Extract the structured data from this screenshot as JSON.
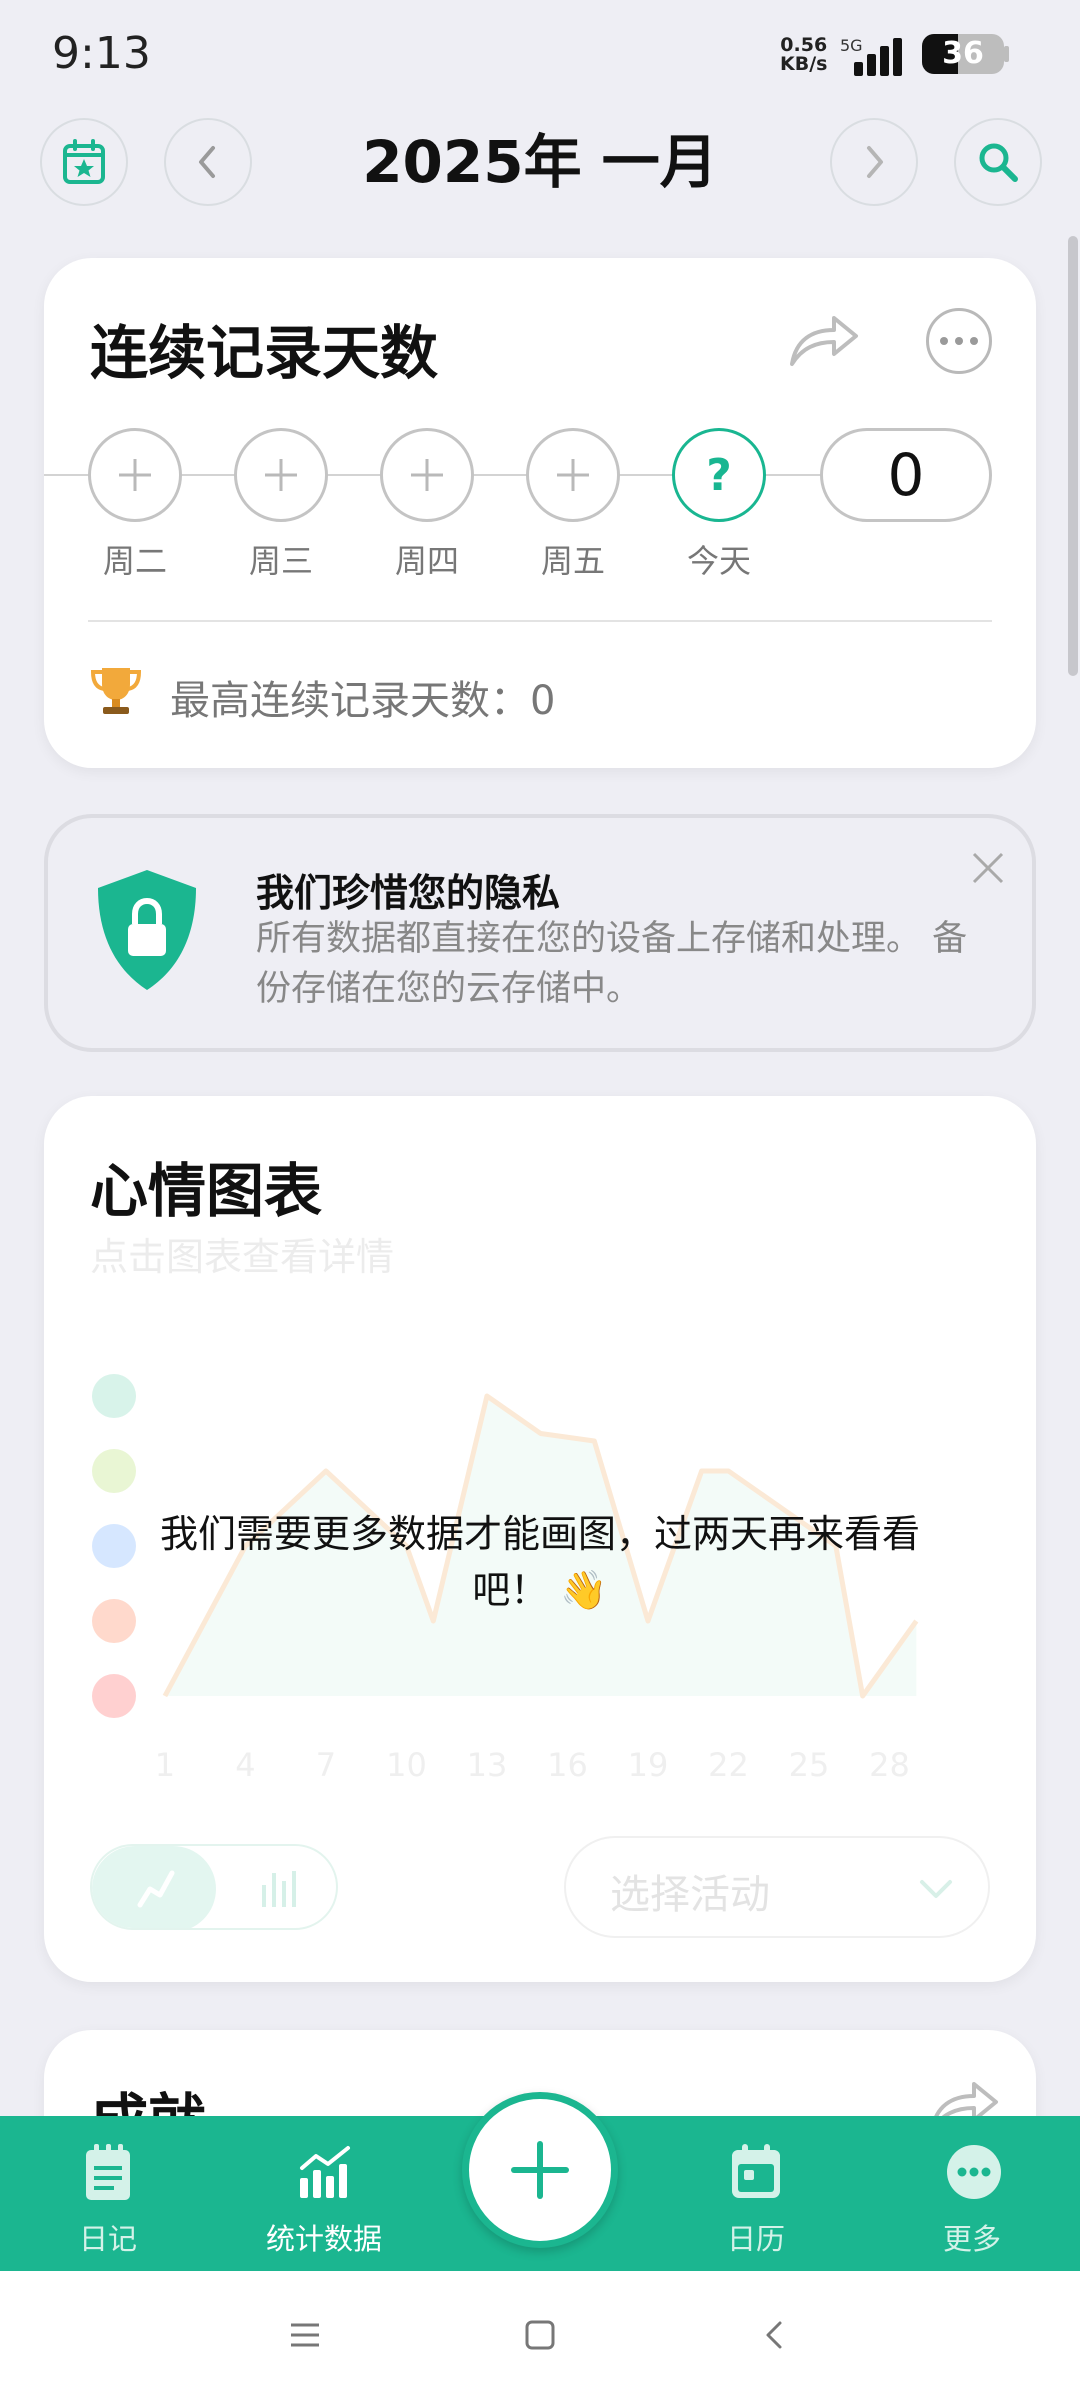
{
  "status_bar": {
    "time": "9:13",
    "speed_value": "0.56",
    "speed_unit": "KB/s",
    "network": "5G",
    "battery": "36"
  },
  "header": {
    "title": "2025年 一月"
  },
  "streak": {
    "title": "连续记录天数",
    "days": [
      "周二",
      "周三",
      "周四",
      "周五",
      "今天"
    ],
    "today_mark": "?",
    "count": "0",
    "best_label": "最高连续记录天数：0"
  },
  "privacy": {
    "title": "我们珍惜您的隐私",
    "body": "所有数据都直接在您的设备上存储和处理。 备份存储在您的云存储中。"
  },
  "mood_chart": {
    "title": "心情图表",
    "subtitle": "点击图表查看详情",
    "empty_message": "我们需要更多数据才能画图，过两天再来看看吧！ 👋",
    "select_placeholder": "选择活动"
  },
  "chart_data": {
    "type": "area",
    "x_ticks": [
      "1",
      "4",
      "7",
      "10",
      "13",
      "16",
      "19",
      "22",
      "25",
      "28"
    ],
    "x": [
      1,
      4,
      7,
      10,
      11,
      13,
      15,
      17,
      19,
      21,
      22,
      24,
      26,
      27,
      29
    ],
    "values": [
      1,
      3,
      4,
      3,
      2,
      5,
      4.5,
      4.4,
      2,
      4,
      4,
      3.5,
      3,
      1,
      2
    ],
    "ylim": [
      1,
      5
    ],
    "y_levels": [
      "awful",
      "bad",
      "meh",
      "good",
      "rad"
    ],
    "grid": false
  },
  "achievements": {
    "title": "成就"
  },
  "bottom_nav": {
    "items": [
      "日记",
      "统计数据",
      "日历",
      "更多"
    ]
  },
  "colors": {
    "accent": "#1bb690",
    "background": "#eeeef4"
  }
}
